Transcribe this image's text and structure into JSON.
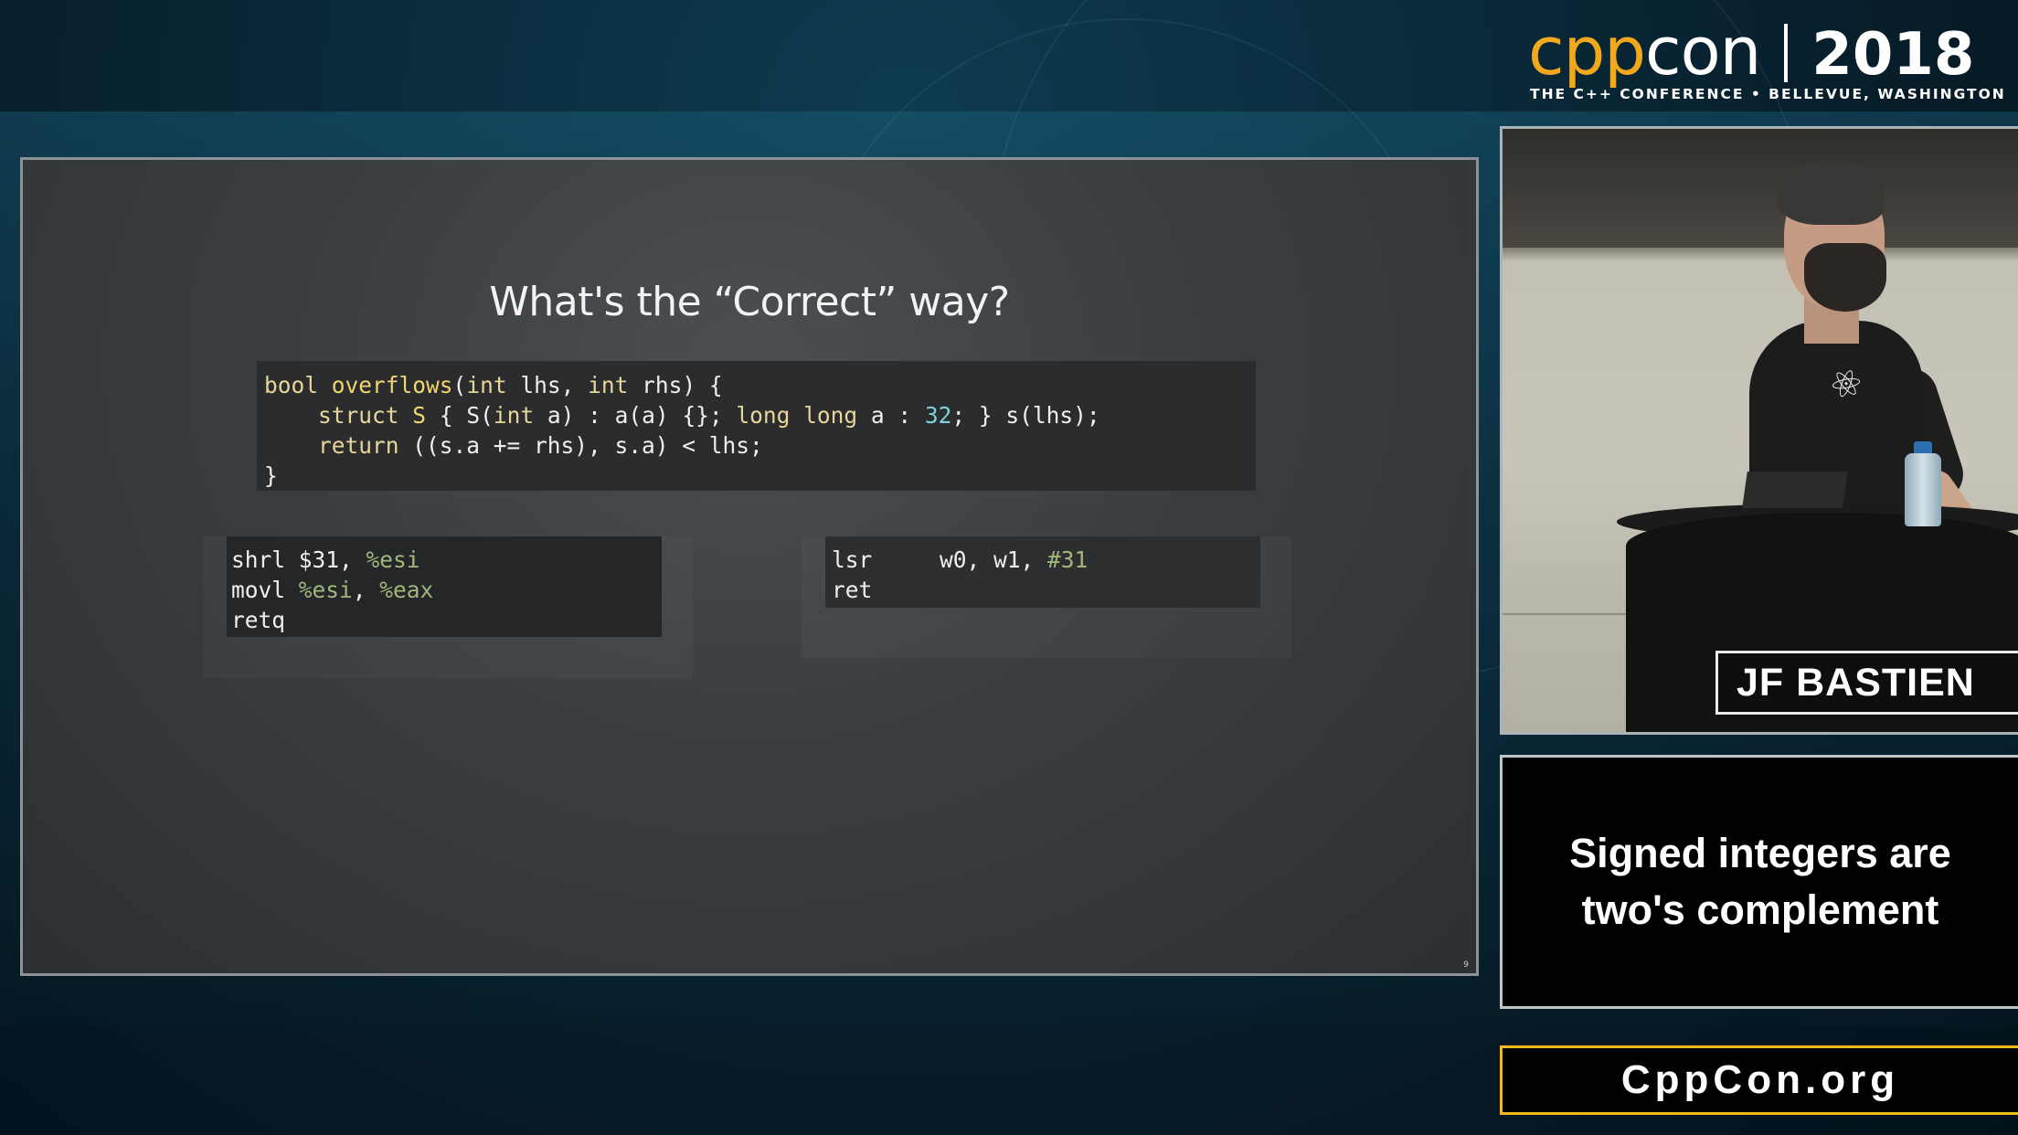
{
  "logo": {
    "cpp": "cpp",
    "con": "con",
    "year": "2018",
    "subtitle": "THE C++ CONFERENCE • BELLEVUE, WASHINGTON",
    "colors": {
      "cpp": "#f2a81d",
      "con": "#ffffff"
    }
  },
  "slide": {
    "title": "What's the “Correct” way?",
    "code_main": {
      "line1": {
        "kw_bool": "bool",
        "fn": "overflows",
        "rest_a": "(",
        "kw_int1": "int",
        "rest_b": " lhs, ",
        "kw_int2": "int",
        "rest_c": " rhs) {"
      },
      "line2": {
        "indent": "    ",
        "kw_struct": "struct",
        "space": " ",
        "ty_S": "S",
        "rest_a": " { S(",
        "kw_int": "int",
        "rest_b": " a) : a(a) {}; ",
        "kw_long": "long long",
        "rest_c": " a : ",
        "num": "32",
        "rest_d": "; } s(lhs);"
      },
      "line3": {
        "indent": "    ",
        "kw_return": "return",
        "rest": " ((s.a += rhs), s.a) < lhs;"
      },
      "line4": "}"
    },
    "code_x86": {
      "l1_op": "shrl $31, ",
      "l1_reg": "%esi",
      "l2_op": "movl ",
      "l2_reg1": "%esi",
      "l2_sep": ", ",
      "l2_reg2": "%eax",
      "l3": "retq"
    },
    "code_arm": {
      "l1_op": "lsr",
      "l1_args": "     w0, w1, ",
      "l1_imm": "#31",
      "l2": "ret"
    },
    "page_number": "9"
  },
  "speaker": {
    "name": "JF BASTIEN"
  },
  "caption": {
    "line1": "Signed integers are",
    "line2": "two's complement"
  },
  "site": {
    "label": "CppCon.org",
    "border_color": "#f2b81d"
  }
}
